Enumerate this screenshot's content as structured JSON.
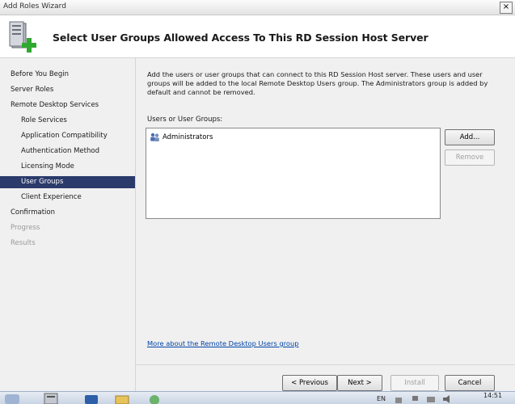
{
  "window": {
    "title": "Add Roles Wizard",
    "close_glyph": "×"
  },
  "header": {
    "heading": "Select User Groups Allowed Access To This RD Session Host Server",
    "icon": "server-add-icon"
  },
  "sidebar": {
    "items": [
      {
        "label": "Before You Begin",
        "level": "top",
        "state": "normal"
      },
      {
        "label": "Server Roles",
        "level": "top",
        "state": "normal"
      },
      {
        "label": "Remote Desktop Services",
        "level": "top",
        "state": "normal"
      },
      {
        "label": "Role Services",
        "level": "sub",
        "state": "normal"
      },
      {
        "label": "Application Compatibility",
        "level": "sub",
        "state": "normal"
      },
      {
        "label": "Authentication Method",
        "level": "sub",
        "state": "normal"
      },
      {
        "label": "Licensing Mode",
        "level": "sub",
        "state": "normal"
      },
      {
        "label": "User Groups",
        "level": "sub",
        "state": "selected"
      },
      {
        "label": "Client Experience",
        "level": "sub",
        "state": "normal"
      },
      {
        "label": "Confirmation",
        "level": "top",
        "state": "normal"
      },
      {
        "label": "Progress",
        "level": "top",
        "state": "disabled"
      },
      {
        "label": "Results",
        "level": "top",
        "state": "disabled"
      }
    ]
  },
  "content": {
    "description": "Add the users or user groups that can connect to this RD Session Host server. These users and user groups will be added to the local Remote Desktop Users group. The Administrators group is added by default and cannot be removed.",
    "list_label": "Users or User Groups:",
    "groups": [
      {
        "name": "Administrators",
        "icon": "user-group-icon"
      }
    ],
    "add_label": "Add...",
    "remove_label": "Remove",
    "more_link": "More about the Remote Desktop Users group"
  },
  "footer": {
    "previous_label": "< Previous",
    "next_label": "Next >",
    "install_label": "Install",
    "cancel_label": "Cancel"
  },
  "taskbar": {
    "tray_lang": "EN",
    "clock": "14:51"
  },
  "colors": {
    "selected_bg": "#2a3a6b",
    "link": "#0044aa",
    "window_bg": "#f0f0f0"
  }
}
